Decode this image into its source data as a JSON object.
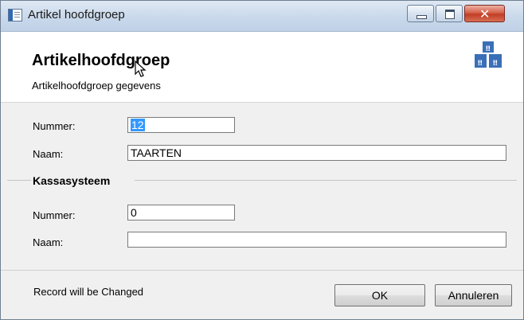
{
  "window": {
    "title": "Artikel hoofdgroep"
  },
  "header": {
    "title": "Artikelhoofdgroep",
    "subtitle": "Artikelhoofdgroep gegevens"
  },
  "main": {
    "nummer_label": "Nummer:",
    "nummer_value": "12",
    "naam_label": "Naam:",
    "naam_value": "TAARTEN"
  },
  "kassa": {
    "section_label": "Kassasysteem",
    "nummer_label": "Nummer:",
    "nummer_value": "0",
    "naam_label": "Naam:",
    "naam_value": ""
  },
  "footer": {
    "status": "Record will be Changed",
    "ok_label": "OK",
    "cancel_label": "Annuleren"
  },
  "icons": [
    "app-icon",
    "minimize-icon",
    "maximize-icon",
    "close-icon",
    "mouse-cursor-icon",
    "boxes-logo-icon"
  ],
  "colors": {
    "selection": "#3399ff",
    "logo_blue": "#3a6fb8",
    "close_red": "#c13d26"
  }
}
